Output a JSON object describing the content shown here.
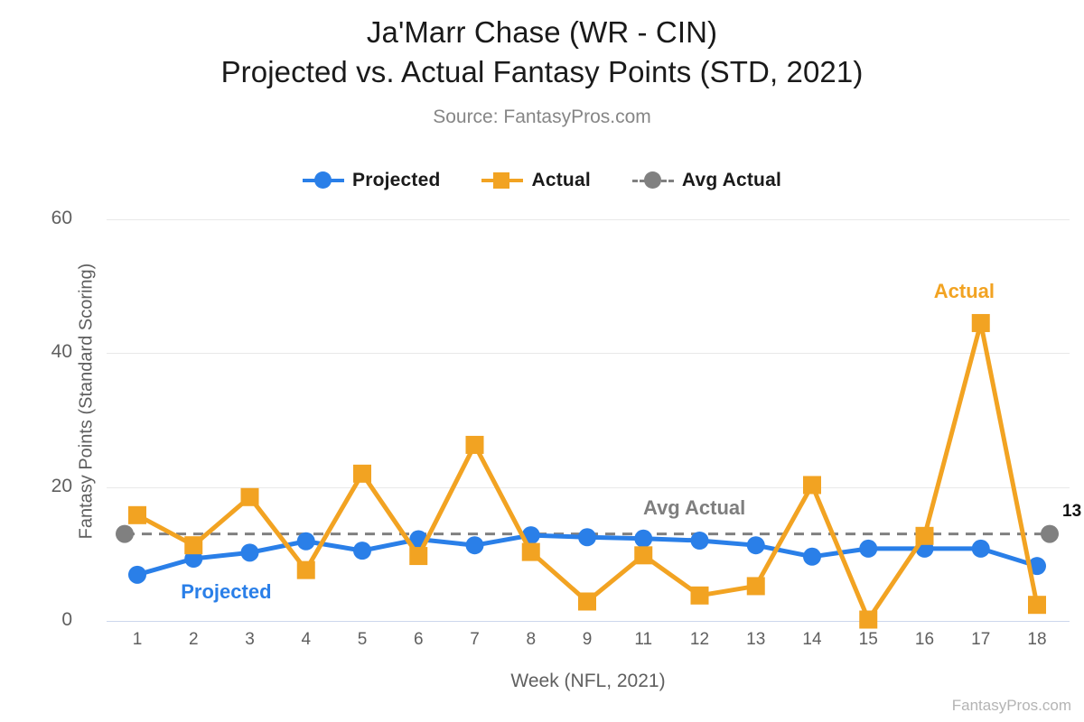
{
  "header": {
    "title_line1": "Ja'Marr Chase (WR - CIN)",
    "title_line2": "Projected vs. Actual Fantasy Points (STD, 2021)",
    "subtitle": "Source: FantasyPros.com"
  },
  "legend": {
    "position": "top-center",
    "items": [
      {
        "label": "Projected",
        "color": "#2a7fe8",
        "marker": "circle",
        "style": "solid"
      },
      {
        "label": "Actual",
        "color": "#f2a322",
        "marker": "square",
        "style": "solid"
      },
      {
        "label": "Avg Actual",
        "color": "#808080",
        "marker": "circle",
        "style": "dashed"
      }
    ]
  },
  "annotations": {
    "projected": "Projected",
    "actual": "Actual",
    "avg_actual": "Avg Actual",
    "end_value": "13"
  },
  "watermark": "FantasyPros.com",
  "colors": {
    "projected": "#2a7fe8",
    "actual": "#f2a322",
    "avg": "#808080",
    "grid": "#e9e9e9",
    "zero_grid": "#ccd7ec",
    "tick_text": "#5f5f5f"
  },
  "chart_data": {
    "type": "line",
    "title": "Ja'Marr Chase (WR - CIN) Projected vs. Actual Fantasy Points (STD, 2021)",
    "subtitle": "Source: FantasyPros.com",
    "xlabel": "Week (NFL, 2021)",
    "ylabel": "Fantasy Points (Standard Scoring)",
    "categories": [
      "1",
      "2",
      "3",
      "4",
      "5",
      "6",
      "7",
      "8",
      "9",
      "11",
      "12",
      "13",
      "14",
      "15",
      "16",
      "17",
      "18"
    ],
    "yticks": [
      0,
      20,
      40,
      60
    ],
    "ylim": [
      0,
      60
    ],
    "grid": true,
    "series": [
      {
        "name": "Projected",
        "color": "#2a7fe8",
        "marker": "circle",
        "style": "solid",
        "values": [
          6.9,
          9.3,
          10.2,
          11.9,
          10.5,
          12.2,
          11.3,
          12.8,
          12.5,
          12.3,
          12.0,
          11.3,
          9.6,
          10.8,
          10.8,
          10.8,
          8.2
        ]
      },
      {
        "name": "Actual",
        "color": "#f2a322",
        "marker": "square",
        "style": "solid",
        "values": [
          15.8,
          11.3,
          18.5,
          7.6,
          22.0,
          9.7,
          26.3,
          10.3,
          2.9,
          9.8,
          3.8,
          5.2,
          20.3,
          0.2,
          12.7,
          44.5,
          2.4
        ]
      },
      {
        "name": "Avg Actual",
        "color": "#808080",
        "marker": "circle",
        "style": "dashed",
        "constant": 13.0,
        "endpoints_only": true
      }
    ]
  }
}
